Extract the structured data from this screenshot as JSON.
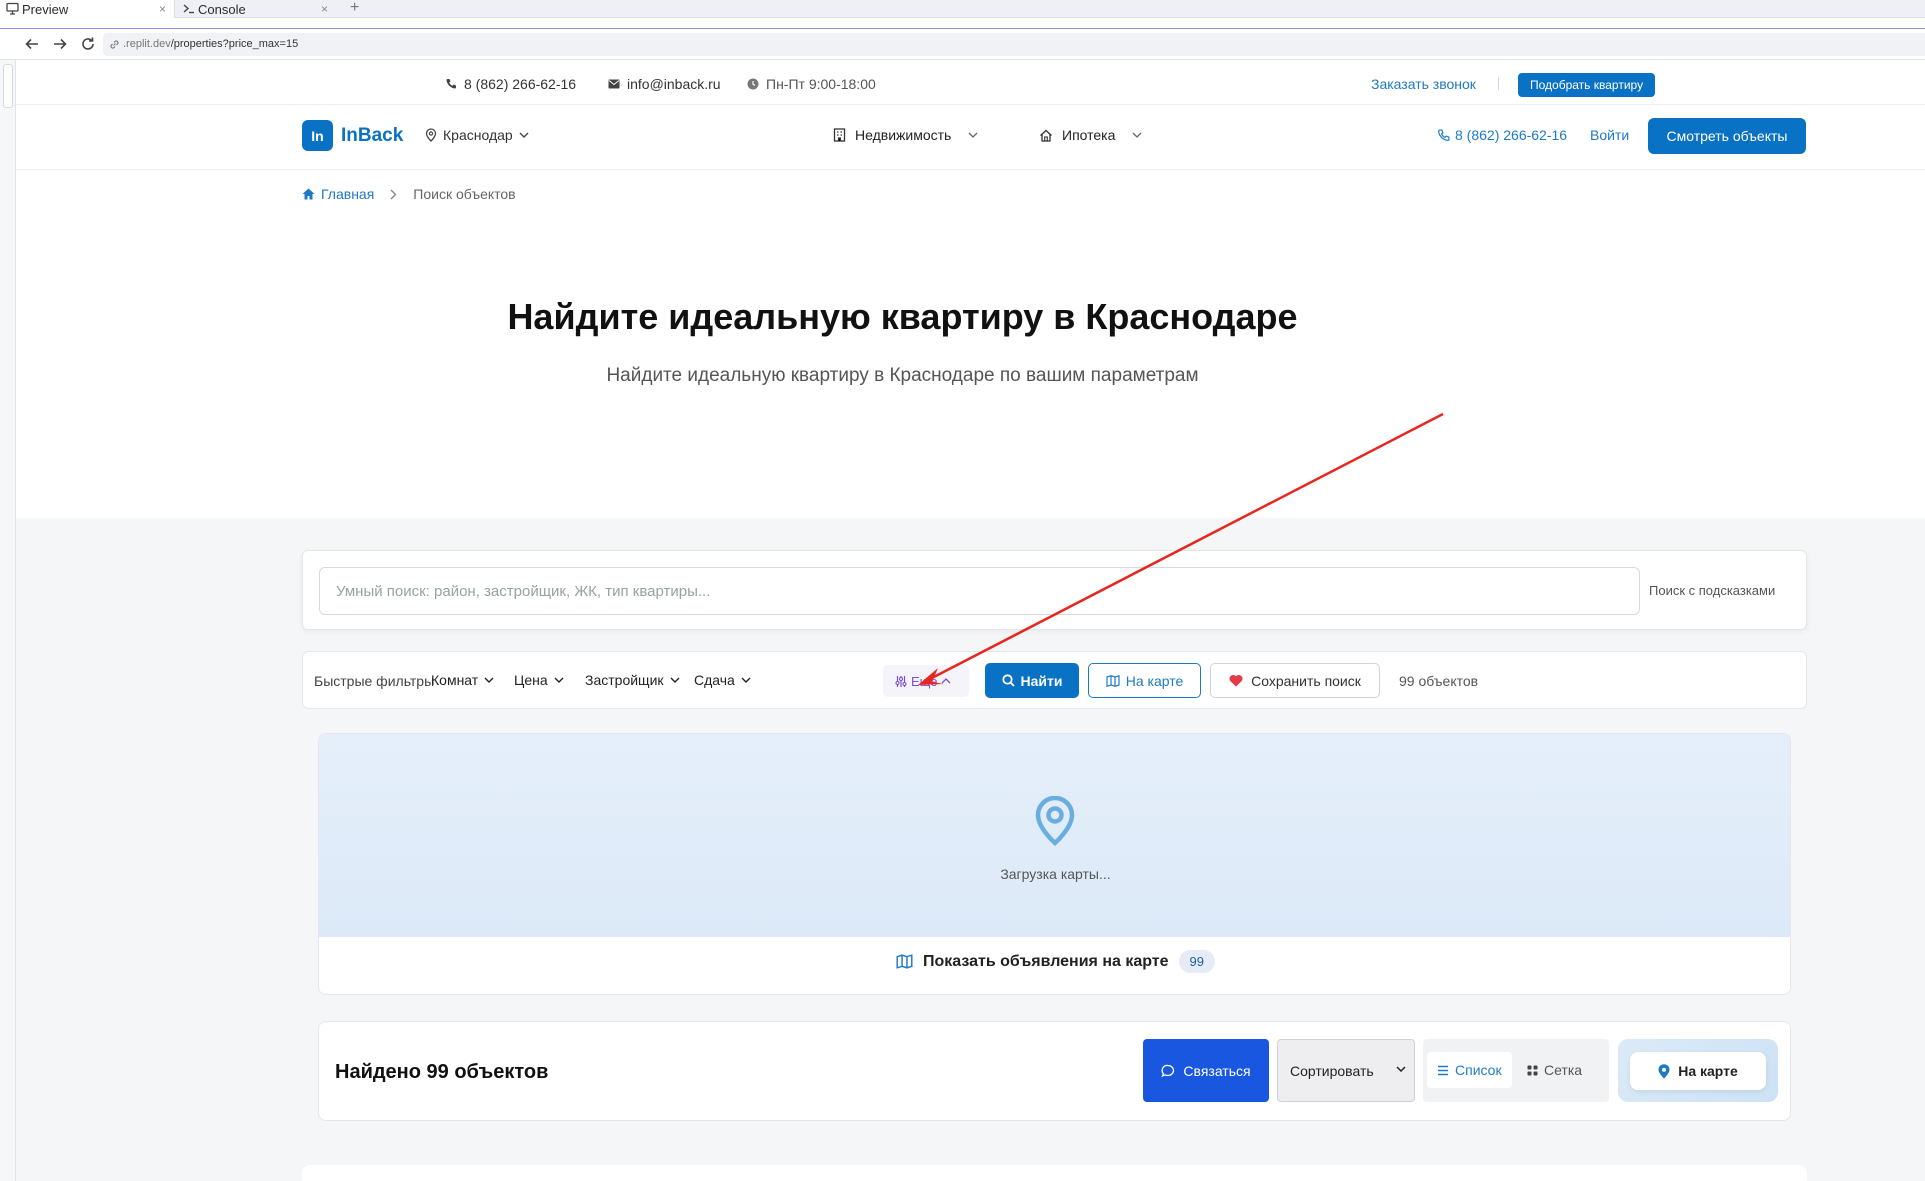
{
  "browser": {
    "tabs": [
      {
        "label": "Preview",
        "icon": "monitor-icon"
      },
      {
        "label": "Console",
        "icon": "terminal-icon"
      }
    ],
    "new_tab_label": "+",
    "close_glyph": "×",
    "url_prefix": ".replit.dev",
    "url_path": "/properties?price_max=15"
  },
  "topinfo": {
    "phone": "8 (862) 266-62-16",
    "email": "info@inback.ru",
    "hours": "Пн-Пт 9:00-18:00",
    "callback": "Заказать звонок",
    "pick_button": "Подобрать квартиру"
  },
  "header": {
    "logo_mark": "In",
    "logo_name": "InBack",
    "city": "Краснодар",
    "nav": [
      "Недвижимость",
      "Ипотека"
    ],
    "phone": "8 (862) 266-62-16",
    "login": "Войти",
    "view_button": "Смотреть объекты"
  },
  "breadcrumb": {
    "home": "Главная",
    "current": "Поиск объектов"
  },
  "hero": {
    "title": "Найдите идеальную квартиру в Краснодаре",
    "subtitle": "Найдите идеальную квартиру в Краснодаре по вашим параметрам"
  },
  "search": {
    "placeholder": "Умный поиск: район, застройщик, ЖК, тип квартиры...",
    "hint": "Поиск с подсказками"
  },
  "filters": {
    "label": "Быстрые фильтры",
    "dropdowns": [
      "Комнат",
      "Цена",
      "Застройщик",
      "Сдача"
    ],
    "more": "Еще",
    "find": "Найти",
    "on_map": "На карте",
    "save": "Сохранить поиск",
    "count": "99 объектов"
  },
  "map": {
    "loading": "Загрузка карты...",
    "show_label": "Показать объявления на карте",
    "show_count": "99"
  },
  "results": {
    "found": "Найдено 99 объектов",
    "contact": "Связаться",
    "sort": "Сортировать",
    "list": "Список",
    "grid": "Сетка",
    "on_map": "На карте"
  },
  "colors": {
    "brand": "#0a72c4",
    "contact": "#1957e0",
    "accent_purple": "#7a4fd8",
    "annotation_arrow": "#e8261f"
  }
}
